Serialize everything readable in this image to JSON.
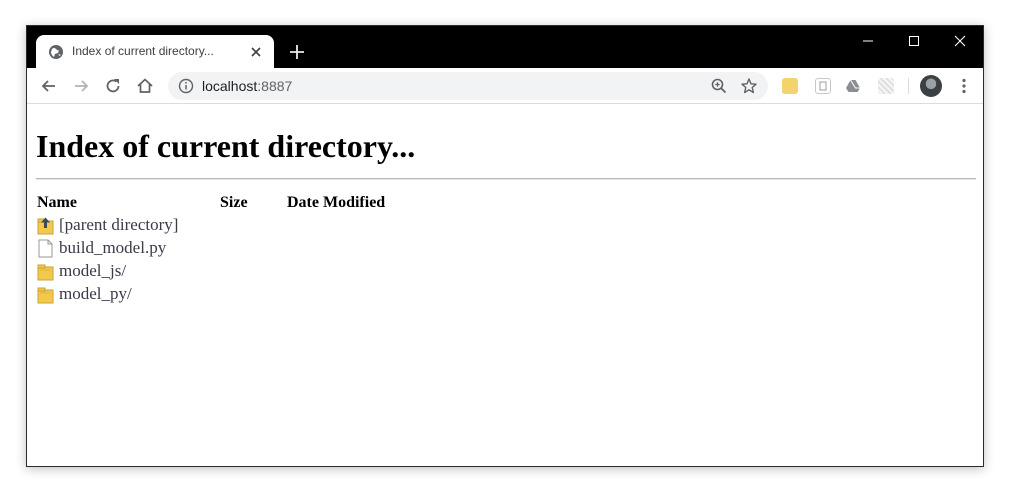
{
  "tab": {
    "title": "Index of current directory...",
    "close_glyph": "✕",
    "new_tab_glyph": "+"
  },
  "window_controls": {
    "icons": [
      "minimize-icon",
      "maximize-icon",
      "close-icon"
    ]
  },
  "toolbar": {
    "url_host": "localhost",
    "url_port": ":8887",
    "icons": [
      "back-arrow-icon",
      "forward-arrow-icon",
      "reload-icon",
      "home-icon",
      "info-icon",
      "zoom-icon",
      "star-icon",
      "menu-dots-icon"
    ]
  },
  "page": {
    "title": "Index of current directory...",
    "headers": {
      "name": "Name",
      "size": "Size",
      "date": "Date Modified"
    },
    "entries": [
      {
        "name": "[parent directory]",
        "icon": "parent-folder-icon"
      },
      {
        "name": "build_model.py",
        "icon": "file-icon"
      },
      {
        "name": "model_js/",
        "icon": "folder-icon"
      },
      {
        "name": "model_py/",
        "icon": "folder-icon"
      }
    ]
  },
  "colors": {
    "titlebar": "#000000",
    "omnibox": "#f1f3f4",
    "link": "#3a3a4a",
    "folder": "#f2c94c"
  }
}
